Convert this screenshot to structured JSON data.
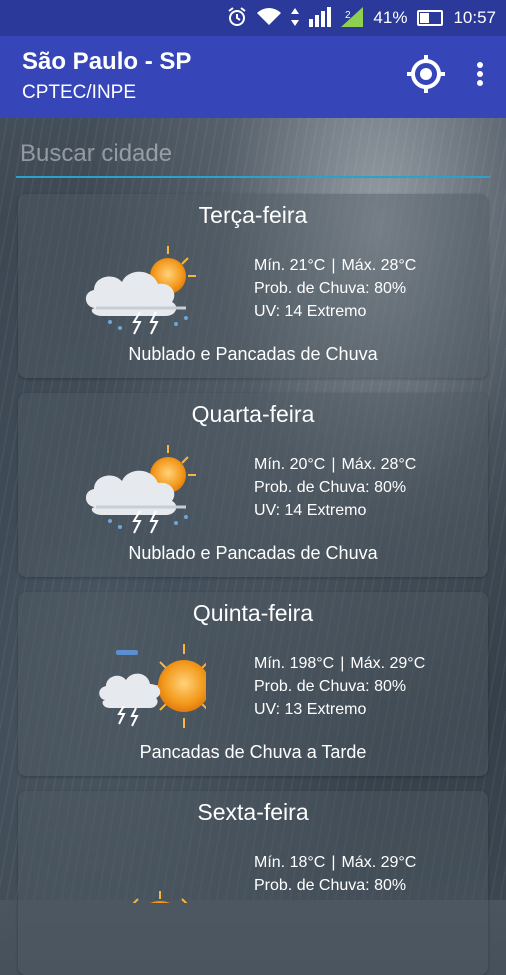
{
  "status_bar": {
    "battery": "41%",
    "time": "10:57",
    "icons": [
      "alarm-icon",
      "wifi-icon",
      "data-arrows-icon",
      "signal-icon",
      "signal-2g-icon",
      "battery-icon"
    ]
  },
  "app_bar": {
    "title": "São Paulo - SP",
    "subtitle": "CPTEC/INPE",
    "icons": [
      "locate-icon",
      "more-vert-icon"
    ]
  },
  "search": {
    "placeholder": "Buscar cidade",
    "value": ""
  },
  "forecasts": [
    {
      "day": "Terça-feira",
      "min": "Mín. 21°C",
      "max": "Máx. 28°C",
      "rain": "Prob. de Chuva: 80%",
      "uv": "UV: 14 Extremo",
      "summary": "Nublado e Pancadas de Chuva",
      "icon": "storm-cloud-sun-icon"
    },
    {
      "day": "Quarta-feira",
      "min": "Mín. 20°C",
      "max": "Máx. 28°C",
      "rain": "Prob. de Chuva: 80%",
      "uv": "UV: 14 Extremo",
      "summary": "Nublado e Pancadas de Chuva",
      "icon": "storm-cloud-sun-icon"
    },
    {
      "day": "Quinta-feira",
      "min": "Mín. 198°C",
      "max": "Máx. 29°C",
      "rain": "Prob. de Chuva: 80%",
      "uv": "UV: 13 Extremo",
      "summary": "Pancadas de Chuva a Tarde",
      "icon": "sun-afternoon-storm-icon"
    },
    {
      "day": "Sexta-feira",
      "min": "Mín. 18°C",
      "max": "Máx. 29°C",
      "rain": "Prob. de Chuva: 80%",
      "uv": "",
      "summary": "",
      "icon": "sun-clouds-icon"
    }
  ],
  "colors": {
    "app_bar": "#3646b8",
    "status_bar": "#2b3a9a",
    "search_underline": "#29a3c9",
    "sun": "#f6a21a"
  }
}
